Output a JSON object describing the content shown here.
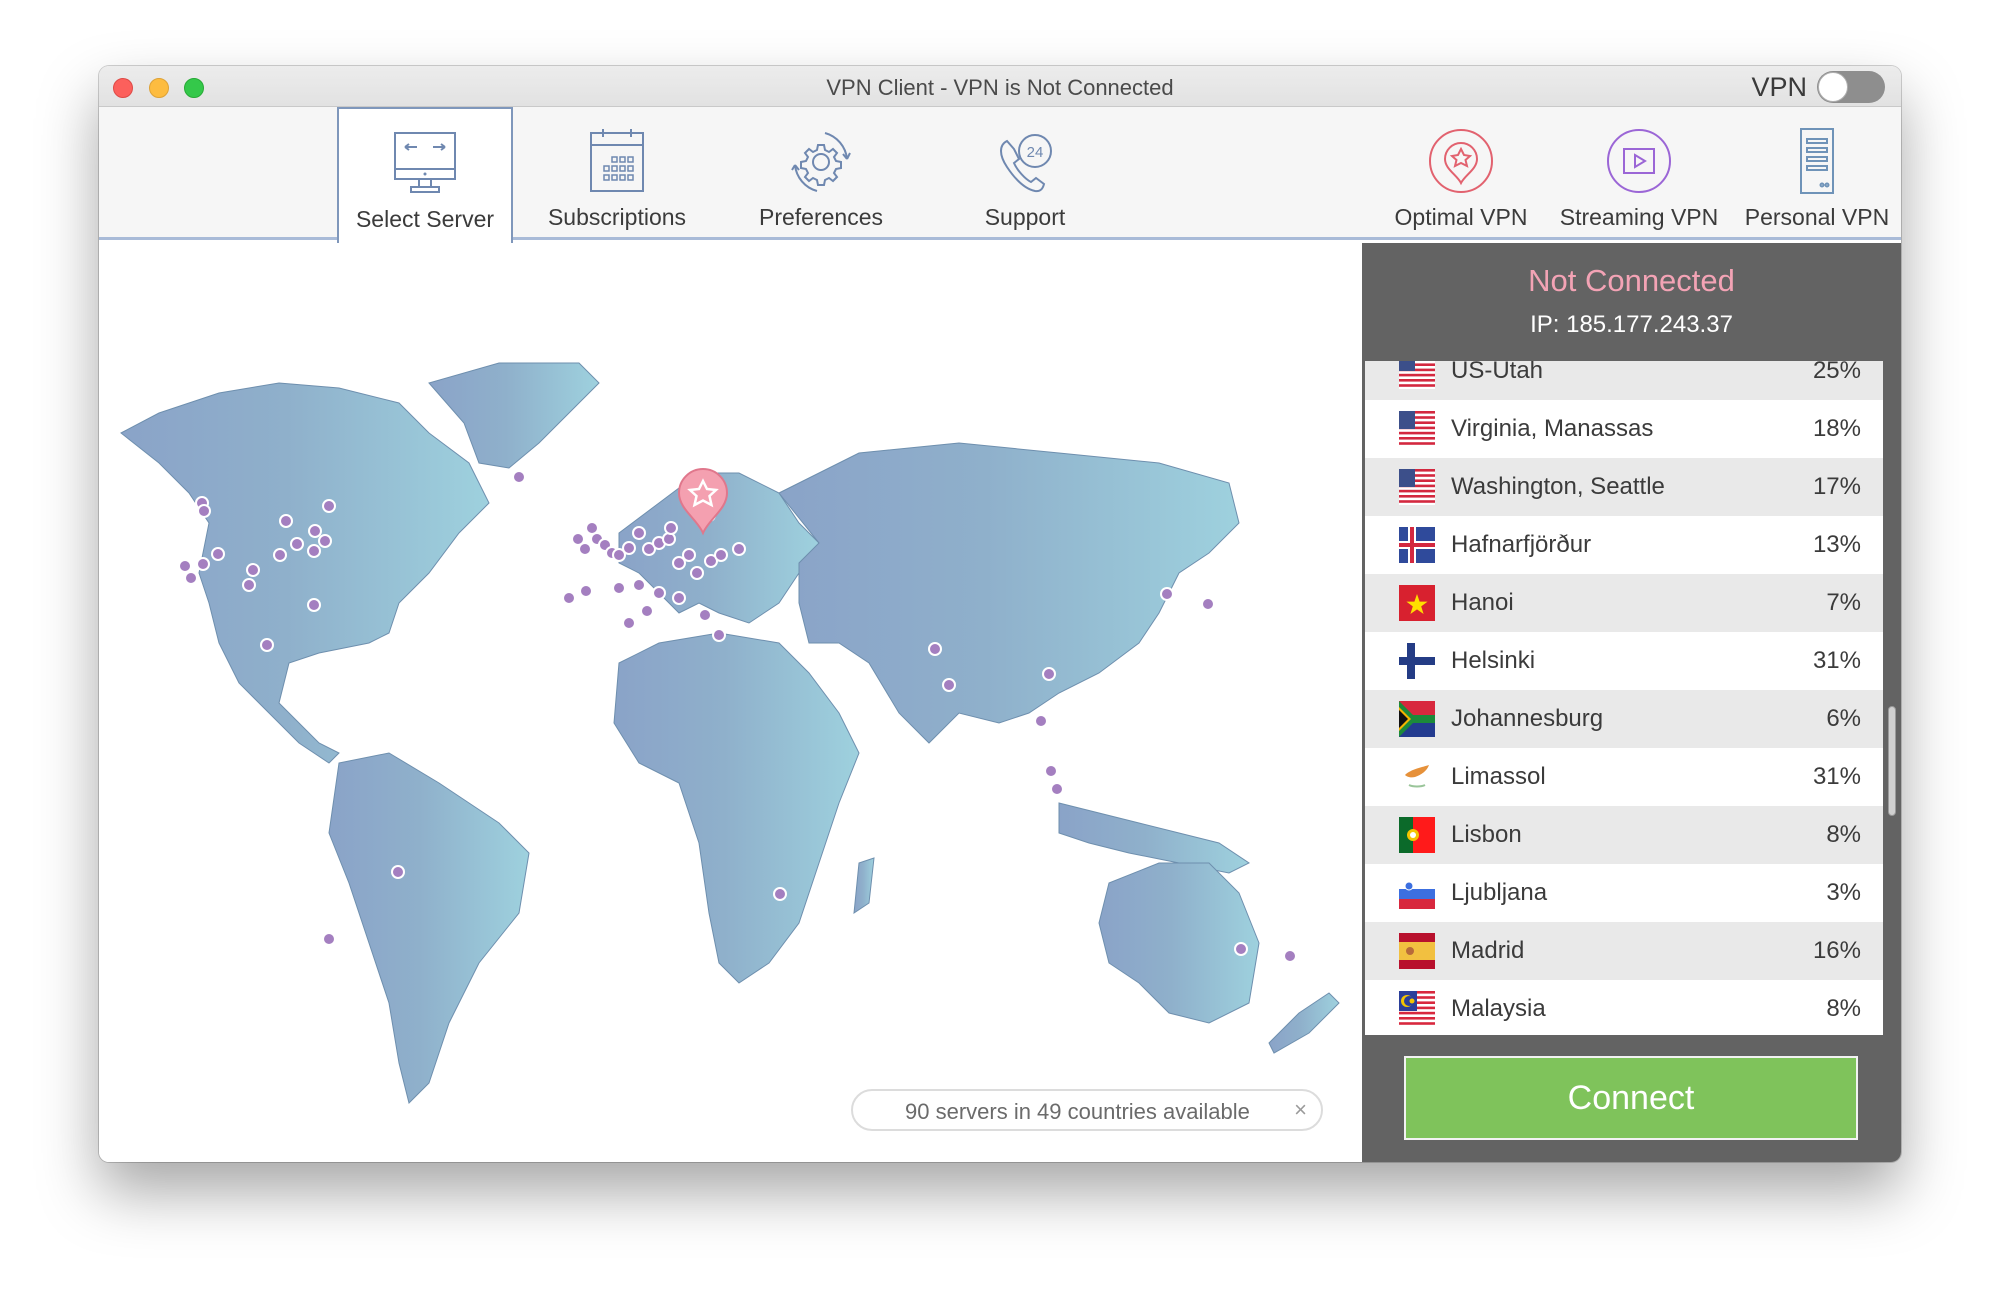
{
  "window": {
    "title": "VPN Client - VPN is Not Connected",
    "vpn_toggle_label": "VPN",
    "vpn_toggle_on": false
  },
  "toolbar": {
    "tabs": [
      {
        "label": "Select Server",
        "icon": "monitor-arrows-icon",
        "active": true
      },
      {
        "label": "Subscriptions",
        "icon": "calendar-icon",
        "active": false
      },
      {
        "label": "Preferences",
        "icon": "gear-refresh-icon",
        "active": false
      },
      {
        "label": "Support",
        "icon": "phone-24-icon",
        "active": false
      }
    ],
    "modes": [
      {
        "label": "Optimal VPN",
        "icon": "location-star-icon",
        "color": "#e2626f"
      },
      {
        "label": "Streaming VPN",
        "icon": "play-icon",
        "color": "#9b66d6"
      },
      {
        "label": "Personal VPN",
        "icon": "server-icon",
        "color": "#6f93b8"
      }
    ]
  },
  "map": {
    "status_text": "90 servers in 49 countries available",
    "close_symbol": "×",
    "land_color_west": "#8ba5c8",
    "land_color_east": "#9dcfdc",
    "marker_color": "#a47fc0",
    "pin_color": "#f4a0b0"
  },
  "side": {
    "status": "Not Connected",
    "ip": "IP: 185.177.243.37",
    "status_color": "#f3a3b5",
    "servers": [
      {
        "name": "US-Utah",
        "load": "25%",
        "flag": "us"
      },
      {
        "name": "Virginia, Manassas",
        "load": "18%",
        "flag": "us"
      },
      {
        "name": "Washington, Seattle",
        "load": "17%",
        "flag": "us"
      },
      {
        "name": "Hafnarfjörður",
        "load": "13%",
        "flag": "is"
      },
      {
        "name": "Hanoi",
        "load": "7%",
        "flag": "vn"
      },
      {
        "name": "Helsinki",
        "load": "31%",
        "flag": "fi"
      },
      {
        "name": "Johannesburg",
        "load": "6%",
        "flag": "za"
      },
      {
        "name": "Limassol",
        "load": "31%",
        "flag": "cy"
      },
      {
        "name": "Lisbon",
        "load": "8%",
        "flag": "pt"
      },
      {
        "name": "Ljubljana",
        "load": "3%",
        "flag": "si"
      },
      {
        "name": "Madrid",
        "load": "16%",
        "flag": "es"
      },
      {
        "name": "Malaysia",
        "load": "8%",
        "flag": "my"
      }
    ],
    "connect_label": "Connect",
    "connect_color": "#7fc35b"
  }
}
